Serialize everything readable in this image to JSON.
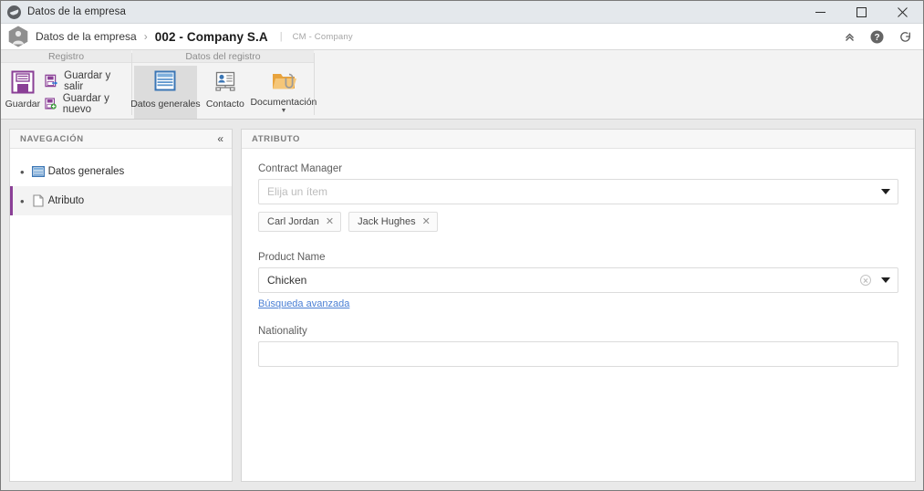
{
  "titlebar": {
    "app_icon": "globe-icon",
    "title": "Datos de la empresa",
    "minimize": "─",
    "maximize": "□",
    "close": "✕"
  },
  "breadcrumb": {
    "app_icon": "user-hexagon-icon",
    "root": "Datos de la empresa",
    "separator": "›",
    "current": "002 - Company S.A",
    "pipe": "|",
    "subtitle": "CM - Company",
    "actions": [
      {
        "name": "collapse-ribbon-icon",
        "glyph": "«"
      },
      {
        "name": "help-icon",
        "glyph": "?"
      },
      {
        "name": "refresh-icon",
        "glyph": "⟳"
      }
    ]
  },
  "ribbon": {
    "groups": [
      {
        "title": "Registro",
        "big_button": {
          "label": "Guardar",
          "icon": "save-floppy-icon"
        },
        "small_buttons": [
          {
            "label": "Guardar y salir",
            "icon": "save-exit-icon"
          },
          {
            "label": "Guardar y nuevo",
            "icon": "save-new-icon"
          }
        ]
      },
      {
        "title": "Datos del registro",
        "tiles": [
          {
            "label": "Datos generales",
            "icon": "window-data-icon",
            "active": true,
            "has_caret": false
          },
          {
            "label": "Contacto",
            "icon": "contact-card-icon",
            "active": false,
            "has_caret": false
          },
          {
            "label": "Documentación",
            "icon": "folder-clip-icon",
            "active": false,
            "has_caret": true,
            "caret": "▼"
          }
        ]
      }
    ]
  },
  "navigation": {
    "header": "NAVEGACIÓN",
    "collapse_glyph": "«",
    "items": [
      {
        "label": "Datos generales",
        "icon": "blue-window-icon",
        "bullet": "•",
        "selected": false
      },
      {
        "label": "Atributo",
        "icon": "document-page-icon",
        "bullet": "•",
        "selected": true
      }
    ]
  },
  "form": {
    "header": "ATRIBUTO",
    "fields": {
      "contract_manager": {
        "label": "Contract Manager",
        "placeholder": "Elija un ítem",
        "value": "",
        "dropdown_icon": "chevron-down-icon",
        "chips": [
          {
            "text": "Carl Jordan",
            "remove": "✕"
          },
          {
            "text": "Jack Hughes",
            "remove": "✕"
          }
        ]
      },
      "product_name": {
        "label": "Product Name",
        "value": "Chicken",
        "clear_icon": "clear-circle-icon",
        "dropdown_icon": "chevron-down-icon",
        "link": "Búsqueda avanzada"
      },
      "nationality": {
        "label": "Nationality",
        "value": "",
        "placeholder": ""
      }
    }
  },
  "colors": {
    "accent_purple": "#8a3f96",
    "link_blue": "#4a7fd4",
    "window_bg": "#e9e9e9",
    "titlebar_bg": "#e4e8ec"
  }
}
